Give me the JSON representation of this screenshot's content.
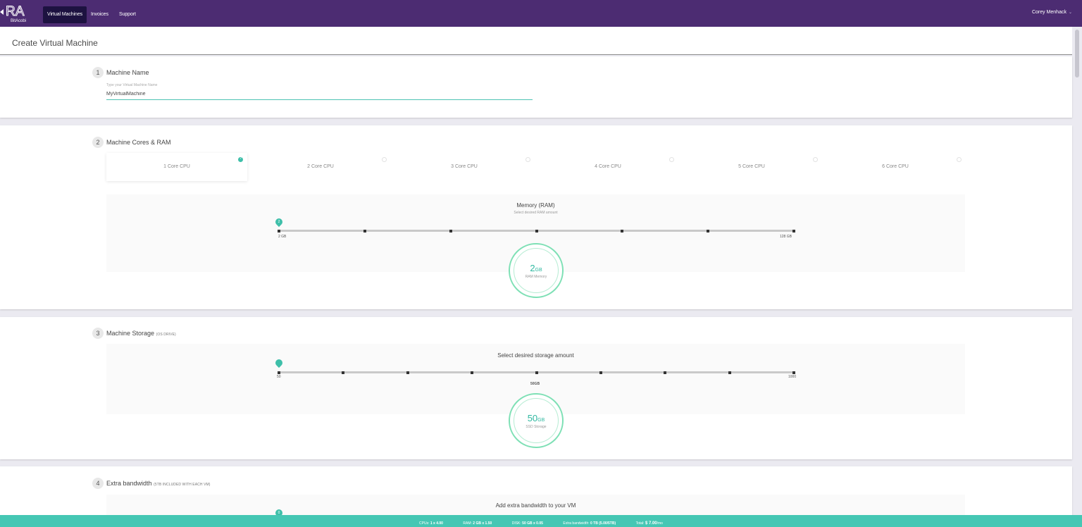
{
  "nav": {
    "logo_top": "RA",
    "logo_bottom": "BitAcobi",
    "items": [
      "Virtual Machines",
      "Invoices",
      "Support"
    ],
    "user": "Corey Menhack"
  },
  "page": {
    "title": "Create Virtual Machine"
  },
  "step1": {
    "number": "1",
    "title": "Machine Name",
    "input_label": "Type your Virtual Machine Name",
    "input_value": "MyVirtualMachine"
  },
  "step2": {
    "number": "2",
    "title": "Machine Cores & RAM",
    "cpu_options": [
      "1 Core CPU",
      "2 Core CPU",
      "3 Core CPU",
      "4 Core CPU",
      "5 Core CPU",
      "6 Core CPU"
    ],
    "selected_cpu_index": 0,
    "memory": {
      "title": "Memory (RAM)",
      "subtitle": "Select desired RAM amount",
      "min_label": "2 GB",
      "max_label": "128 GB",
      "pin_value": "2",
      "gauge_value": "2",
      "gauge_unit": "GB",
      "gauge_label": "RAM Memory",
      "level": 0
    }
  },
  "step3": {
    "number": "3",
    "title": "Machine Storage",
    "title_note": "(OS DRIVE)",
    "storage": {
      "title": "Select desired storage amount",
      "min_label": "50",
      "mid_label": "50GB",
      "max_label": "1000",
      "gauge_value": "50",
      "gauge_unit": "GB",
      "gauge_label": "SSD Storage",
      "level": 0
    }
  },
  "step4": {
    "number": "4",
    "title": "Extra bandwidth",
    "title_note": "(5TB INCLUDED WITH EACH VM)",
    "bandwidth": {
      "title": "Add extra bandwidth to your VM",
      "pin_value": "0"
    }
  },
  "summary": {
    "cpu_label": "CPUs:",
    "cpu_value": "1 x 4.00",
    "ram_label": "RAM:",
    "ram_value": "2 GB x 1.50",
    "disk_label": "DISK:",
    "disk_value": "50 GB x 0.05",
    "bw_label": "Extra bandwidth:",
    "bw_value": "0 TB (5.00/5TB)",
    "total_label": "Total:",
    "total_value": "$ 7.00",
    "total_unit": "/mo"
  },
  "colors": {
    "nav_bg": "#4c2c72",
    "accent": "#45c7b4",
    "gauge_ring": "#7ee0b5"
  }
}
